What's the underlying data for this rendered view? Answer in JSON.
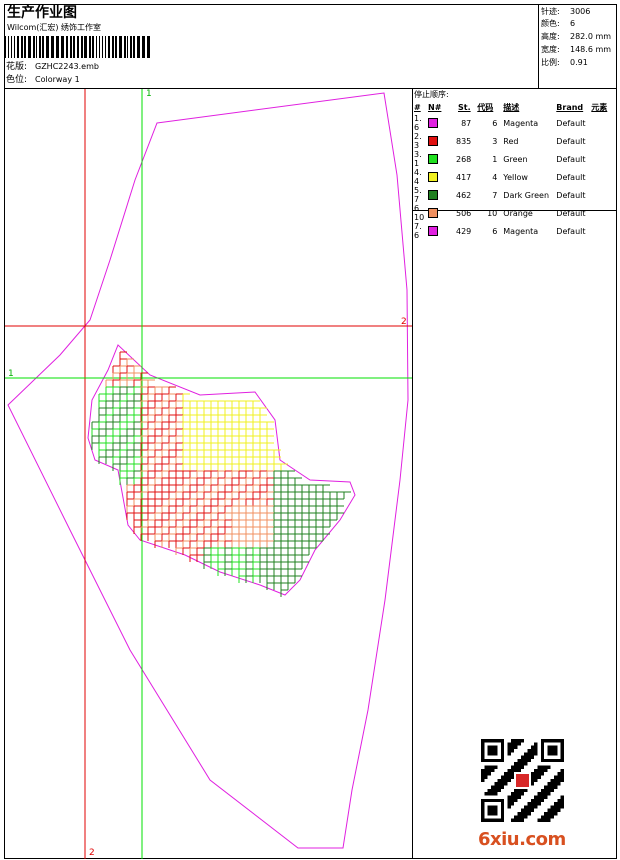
{
  "header": {
    "title": "生产作业图",
    "company": "Wilcom(汇宏) 绣饰工作室",
    "design_label": "花版:",
    "design_value": "GZHC2243.emb",
    "colorway_label": "色位:",
    "colorway_value": "Colorway 1"
  },
  "stats": {
    "stitches_label": "针迹:",
    "stitches_value": "3006",
    "colors_label": "颜色:",
    "colors_value": "6",
    "height_label": "高度:",
    "height_value": "282.0 mm",
    "width_label": "宽度:",
    "width_value": "148.6 mm",
    "scale_label": "比例:",
    "scale_value": "0.91"
  },
  "stop_sequence": {
    "title": "停止顺序:",
    "headers": [
      "#",
      "N#",
      "St.",
      "代码",
      "描述",
      "Brand",
      "元素"
    ],
    "rows": [
      {
        "num": "1. 6",
        "stitches": "87",
        "code": "6",
        "desc": "Magenta",
        "brand": "Default",
        "color": "#e020e0"
      },
      {
        "num": "2. 3",
        "stitches": "835",
        "code": "3",
        "desc": "Red",
        "brand": "Default",
        "color": "#e01010"
      },
      {
        "num": "3. 1",
        "stitches": "268",
        "code": "1",
        "desc": "Green",
        "brand": "Default",
        "color": "#20e020"
      },
      {
        "num": "4. 4",
        "stitches": "417",
        "code": "4",
        "desc": "Yellow",
        "brand": "Default",
        "color": "#f0f020"
      },
      {
        "num": "5. 7",
        "stitches": "462",
        "code": "7",
        "desc": "Dark Green",
        "brand": "Default",
        "color": "#208020"
      },
      {
        "num": "6. 10",
        "stitches": "506",
        "code": "10",
        "desc": "Orange",
        "brand": "Default",
        "color": "#f09060"
      },
      {
        "num": "7. 6",
        "stitches": "429",
        "code": "6",
        "desc": "Magenta",
        "brand": "Default",
        "color": "#e020e0"
      }
    ]
  },
  "guides": {
    "green_label_1": "1",
    "green_label_2": "1",
    "red_label_1": "2",
    "red_label_2": "2"
  },
  "watermark": "6xiu.com",
  "colors": {
    "guide_red": "#e00000",
    "guide_green": "#00e000",
    "outline": "#e020e0"
  }
}
